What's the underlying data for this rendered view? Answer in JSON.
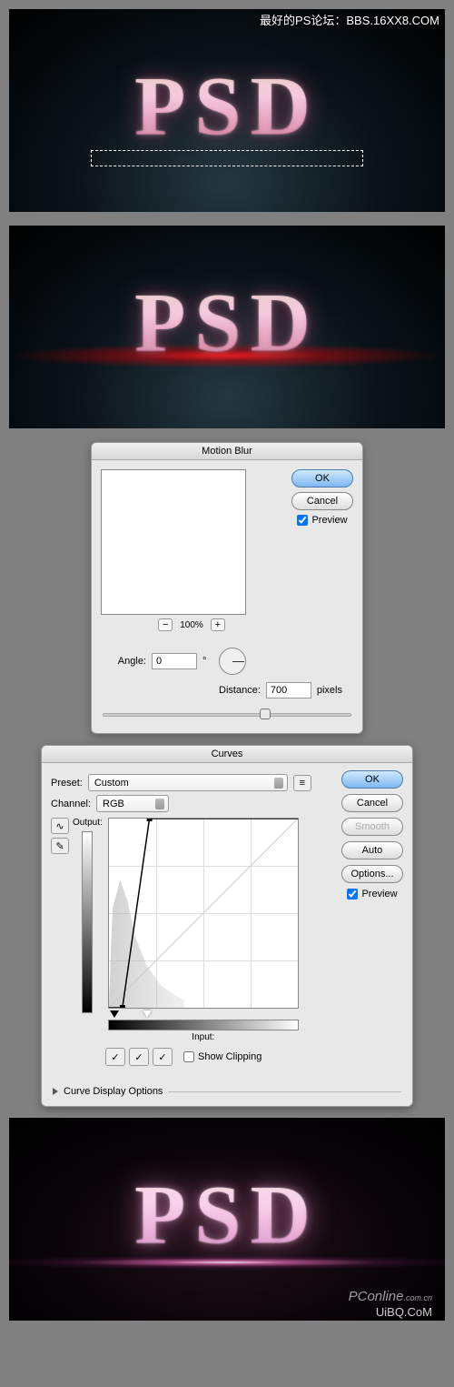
{
  "watermark_top": "最好的PS论坛：BBS.16XX8.COM",
  "watermark_pc": "PConline",
  "watermark_pc_suffix": ".com.cn",
  "watermark_uibq": "UiBQ.CoM",
  "psd_text": "PSD",
  "motion_blur": {
    "title": "Motion Blur",
    "ok": "OK",
    "cancel": "Cancel",
    "preview_label": "Preview",
    "preview_checked": true,
    "zoom": "100%",
    "angle_label": "Angle:",
    "angle_value": "0",
    "degree": "°",
    "distance_label": "Distance:",
    "distance_value": "700",
    "distance_unit": "pixels"
  },
  "curves": {
    "title": "Curves",
    "preset_label": "Preset:",
    "preset_value": "Custom",
    "channel_label": "Channel:",
    "channel_value": "RGB",
    "ok": "OK",
    "cancel": "Cancel",
    "smooth": "Smooth",
    "auto": "Auto",
    "options": "Options...",
    "preview_label": "Preview",
    "preview_checked": true,
    "output_label": "Output:",
    "input_label": "Input:",
    "show_clipping": "Show Clipping",
    "show_clipping_checked": false,
    "disclosure": "Curve Display Options"
  },
  "chart_data": {
    "type": "line",
    "title": "Curves",
    "xlabel": "Input",
    "ylabel": "Output",
    "xlim": [
      0,
      255
    ],
    "ylim": [
      0,
      255
    ],
    "series": [
      {
        "name": "curve",
        "x": [
          0,
          18,
          55,
          55
        ],
        "y": [
          0,
          0,
          255,
          255
        ]
      },
      {
        "name": "baseline",
        "x": [
          0,
          255
        ],
        "y": [
          0,
          255
        ]
      }
    ]
  }
}
